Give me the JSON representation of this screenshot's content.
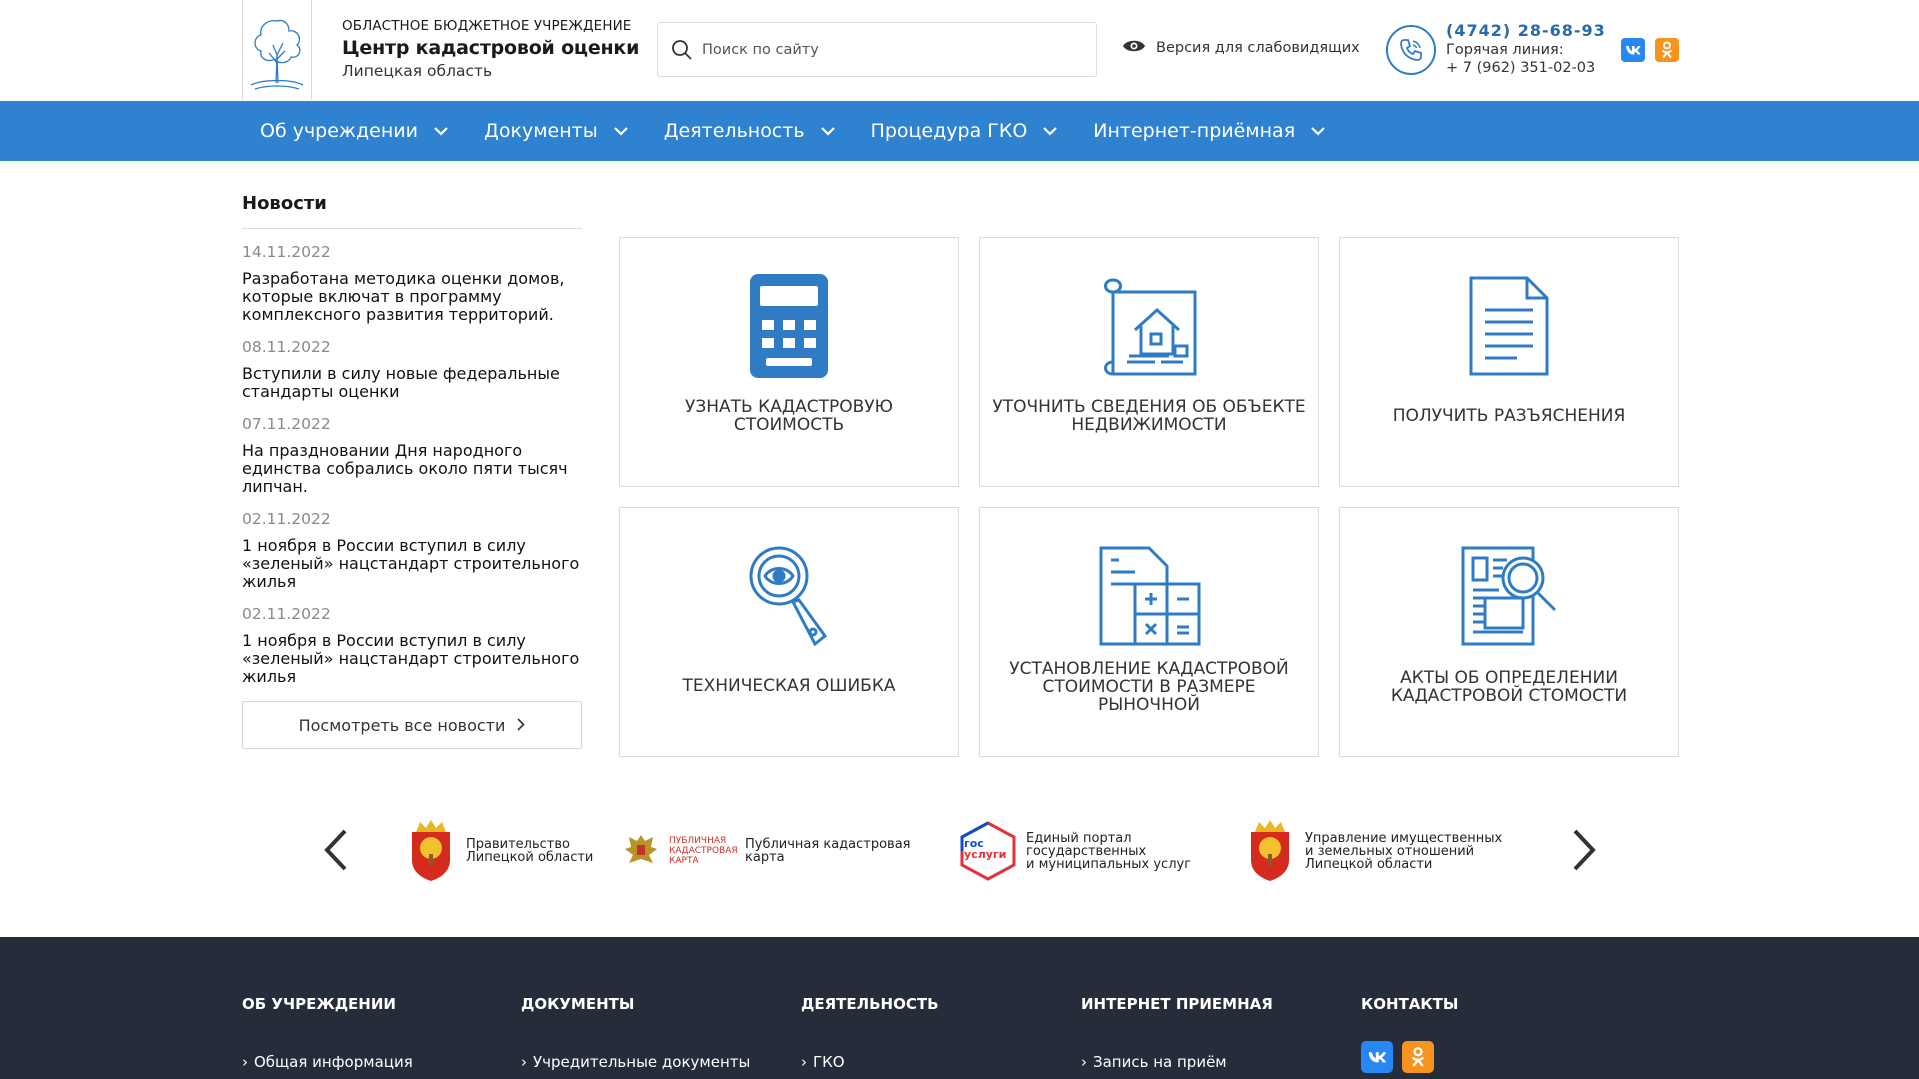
{
  "header": {
    "org_type": "ОБЛАСТНОЕ БЮДЖЕТНОЕ УЧРЕЖДЕНИЕ",
    "org_name": "Центр кадастровой оценки",
    "org_region": "Липецкая область",
    "search_placeholder": "Поиск по сайту",
    "vision_label": "Версия для слабовидящих",
    "phone_main": "(4742) 28-68-93",
    "hotline_label": "Горячая линия:",
    "hotline_phone": "+ 7 (962) 351-02-03",
    "social": {
      "vk": "vk",
      "ok": "ok"
    }
  },
  "nav": {
    "items": [
      {
        "label": "Об учреждении"
      },
      {
        "label": "Документы"
      },
      {
        "label": "Деятельность"
      },
      {
        "label": "Процедура ГКО"
      },
      {
        "label": "Интернет-приёмная"
      }
    ]
  },
  "news": {
    "heading": "Новости",
    "items": [
      {
        "date": "14.11.2022",
        "title": "Разработана методика оценки домов, которые включат в программу комплексного развития территорий."
      },
      {
        "date": "08.11.2022",
        "title": "Вступили в силу новые федеральные стандарты оценки"
      },
      {
        "date": "07.11.2022",
        "title": "На праздновании Дня народного единства собрались около пяти тысяч липчан."
      },
      {
        "date": "02.11.2022",
        "title": "1 ноября в России вступил в силу «зеленый» нацстандарт строительного жилья"
      },
      {
        "date": "02.11.2022",
        "title": "1 ноября в России вступил в силу «зеленый» нацстандарт строительного жилья"
      }
    ],
    "all_label": "Посмотреть все новости"
  },
  "tiles": [
    {
      "label": "Узнать кадастровую стоимость",
      "icon": "calculator-icon"
    },
    {
      "label": "Уточнить сведения об объекте недвижимости",
      "icon": "house-blueprint-icon"
    },
    {
      "label": "Получить разъяснения",
      "icon": "document-icon"
    },
    {
      "label": "Техническая ошибка",
      "icon": "magnifier-eye-icon"
    },
    {
      "label": "Установление кадастровой стоимости в размере рыночной",
      "icon": "calc-document-icon"
    },
    {
      "label": "Акты об определении кадастровой стомости",
      "icon": "newspaper-search-icon"
    }
  ],
  "partners": [
    {
      "name": "Правительство Липецкой области",
      "lines": [
        "Правительство",
        "Липецкой области"
      ]
    },
    {
      "name": "Публичная кадастровая карта",
      "lines": [
        "Публичная кадастровая",
        "карта"
      ],
      "logo_text": [
        "ПУБЛИЧНАЯ",
        "КАДАСТРОВАЯ",
        "КАРТА"
      ]
    },
    {
      "name": "Единый портал государственных и муниципальных услуг",
      "lines": [
        "Единый портал",
        "государственных",
        "и муниципальных услуг"
      ],
      "logo_text": [
        "гос",
        "услуги"
      ]
    },
    {
      "name": "Управление имущественных и земельных отношений Липецкой области",
      "lines": [
        "Управление имущественных",
        "и земельных отношений",
        "Липецкой области"
      ]
    }
  ],
  "footer": {
    "columns": [
      {
        "head": "Об учреждении",
        "link": "Общая информация"
      },
      {
        "head": "Документы",
        "link": "Учредительные документы"
      },
      {
        "head": "Деятельность",
        "link": "ГКО"
      },
      {
        "head": "Интернет приемная",
        "link": "Запись на приём"
      },
      {
        "head": "Контакты"
      }
    ]
  },
  "colors": {
    "accent": "#2f82cf",
    "footer": "#252d3b",
    "icon_blue": "#2f7cc4"
  }
}
